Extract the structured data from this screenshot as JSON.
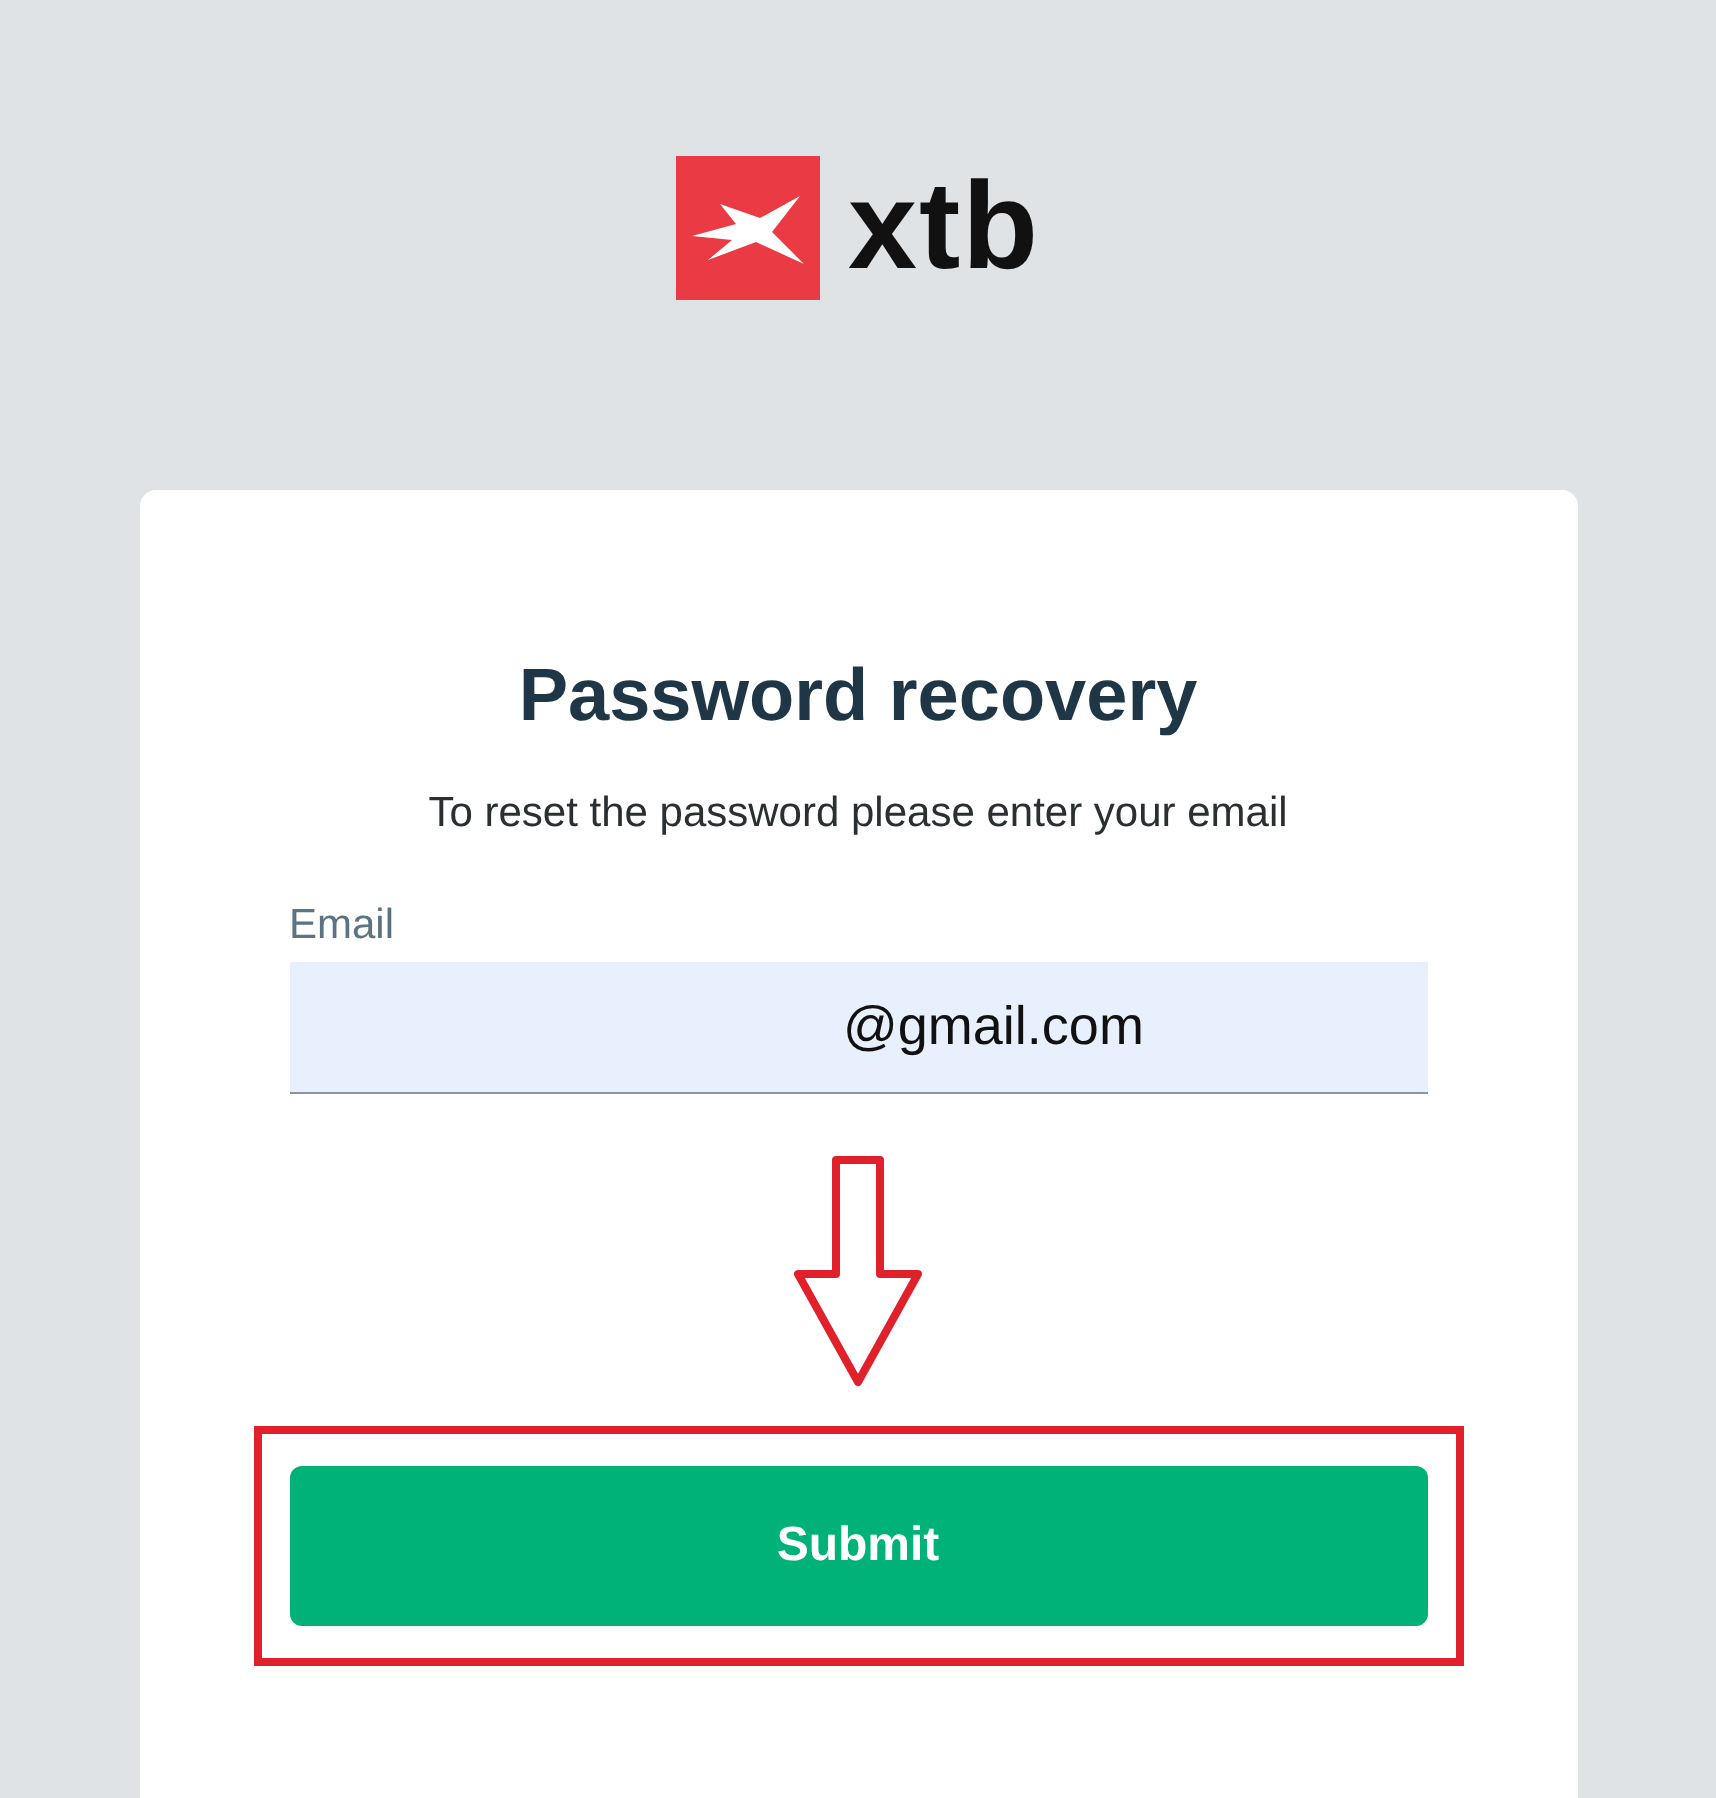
{
  "logo": {
    "text": "xtb"
  },
  "card": {
    "title": "Password recovery",
    "subtitle": "To reset the password please enter your email",
    "email": {
      "label": "Email",
      "value": "@gmail.com"
    },
    "submit": {
      "label": "Submit",
      "highlighted": true
    }
  }
}
